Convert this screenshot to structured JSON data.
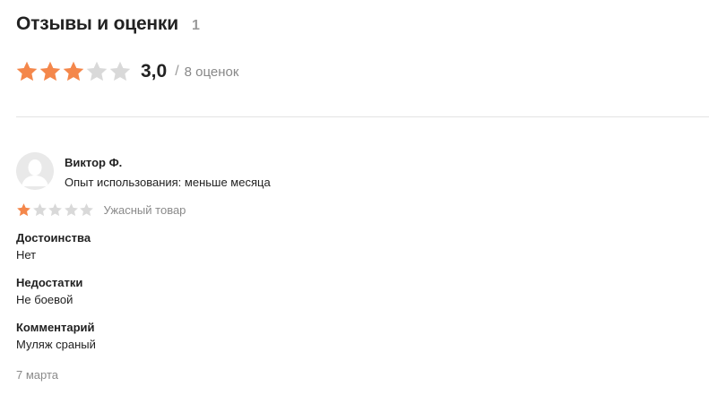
{
  "header": {
    "title": "Отзывы и оценки",
    "review_count": "1"
  },
  "summary": {
    "rating": 3,
    "max_rating": 5,
    "score_text": "3,0",
    "separator": "/",
    "ratings_count_text": "8 оценок"
  },
  "colors": {
    "star_filled": "#f4874b",
    "star_empty": "#d9d9d9"
  },
  "review": {
    "author": "Виктор Ф.",
    "usage": "Опыт использования: меньше месяца",
    "rating": 1,
    "verdict": "Ужасный товар",
    "pros_title": "Достоинства",
    "pros_text": "Нет",
    "cons_title": "Недостатки",
    "cons_text": "Не боевой",
    "comment_title": "Комментарий",
    "comment_text": "Муляж сраный",
    "date": "7 марта"
  }
}
